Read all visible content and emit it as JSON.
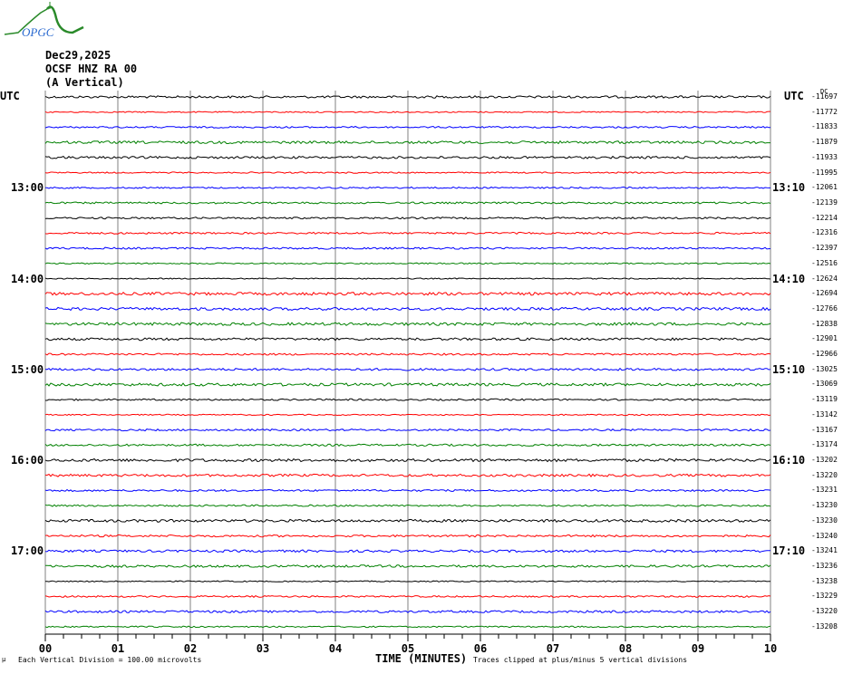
{
  "logo_text": "OPGC",
  "header": {
    "date": "Dec29,2025",
    "station": "OCSF HNZ RA 00",
    "component": "(A Vertical)"
  },
  "utc_left": "UTC",
  "utc_right": "UTC",
  "dc_label": "DC",
  "colors": [
    "#000000",
    "#ff0000",
    "#0000ff",
    "#008000"
  ],
  "chart_data": {
    "type": "line",
    "title": "OCSF HNZ RA 00 (A Vertical) Dec29,2025",
    "xlabel": "TIME (MINUTES)",
    "xlim": [
      0,
      10
    ],
    "x_ticks": [
      "00",
      "01",
      "02",
      "03",
      "04",
      "05",
      "06",
      "07",
      "08",
      "09",
      "10"
    ],
    "grid": true,
    "left_time_labels": [
      {
        "row": 6,
        "text": "13:00"
      },
      {
        "row": 12,
        "text": "14:00"
      },
      {
        "row": 18,
        "text": "15:00"
      },
      {
        "row": 24,
        "text": "16:00"
      },
      {
        "row": 30,
        "text": "17:00"
      }
    ],
    "right_time_labels": [
      {
        "row": 6,
        "text": "13:10"
      },
      {
        "row": 12,
        "text": "14:10"
      },
      {
        "row": 18,
        "text": "15:10"
      },
      {
        "row": 24,
        "text": "16:10"
      },
      {
        "row": 30,
        "text": "17:10"
      }
    ],
    "row_dc_offsets": [
      "-11697",
      "-11772",
      "-11833",
      "-11879",
      "-11933",
      "-11995",
      "-12061",
      "-12139",
      "-12214",
      "-12316",
      "-12397",
      "-12516",
      "-12624",
      "-12694",
      "-12766",
      "-12838",
      "-12901",
      "-12966",
      "-13025",
      "-13069",
      "-13119",
      "-13142",
      "-13167",
      "-13174",
      "-13202",
      "-13220",
      "-13231",
      "-13230",
      "-13230",
      "-13240",
      "-13241",
      "-13236",
      "-13238",
      "-13229",
      "-13220",
      "-13208"
    ],
    "vertical_division": "Each Vertical Division =  100.00 microvolts",
    "clip_note": "Traces clipped at plus/minus 5 vertical divisions"
  }
}
